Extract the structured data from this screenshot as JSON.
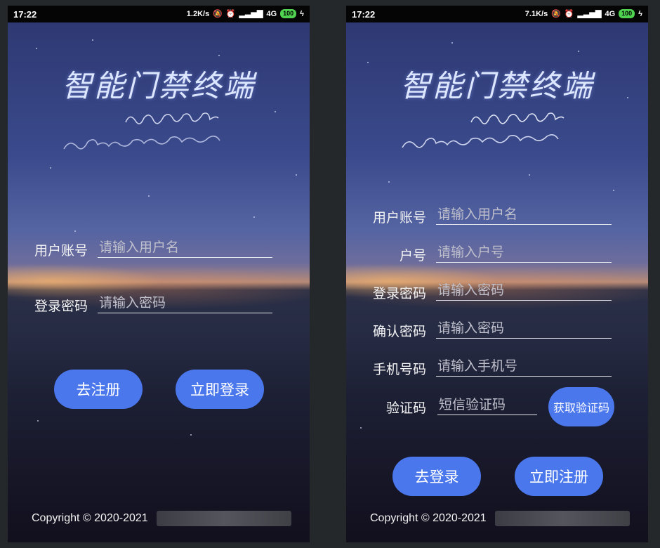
{
  "left_screen": {
    "status": {
      "time": "17:22",
      "speed": "1.2K/s",
      "network": "4G",
      "battery": "100"
    },
    "title": "智能门禁终端",
    "fields": [
      {
        "label": "用户账号",
        "placeholder": "请输入用户名"
      },
      {
        "label": "登录密码",
        "placeholder": "请输入密码"
      }
    ],
    "buttons": {
      "register": "去注册",
      "login": "立即登录"
    },
    "copyright": "Copyright © 2020-2021"
  },
  "right_screen": {
    "status": {
      "time": "17:22",
      "speed": "7.1K/s",
      "network": "4G",
      "battery": "100"
    },
    "title": "智能门禁终端",
    "fields": [
      {
        "label": "用户账号",
        "placeholder": "请输入用户名"
      },
      {
        "label": "户号",
        "placeholder": "请输入户号"
      },
      {
        "label": "登录密码",
        "placeholder": "请输入密码"
      },
      {
        "label": "确认密码",
        "placeholder": "请输入密码"
      },
      {
        "label": "手机号码",
        "placeholder": "请输入手机号"
      },
      {
        "label": "验证码",
        "placeholder": "短信验证码"
      }
    ],
    "sms_button": "获取验证码",
    "buttons": {
      "login": "去登录",
      "register": "立即注册"
    },
    "copyright": "Copyright © 2020-2021"
  },
  "colors": {
    "accent": "#4a77ec",
    "statusbar": "#050506",
    "battery": "#4fd24f"
  },
  "icons": [
    "mute-icon",
    "alarm-icon",
    "signal-icon",
    "hd-icon",
    "battery-icon",
    "charging-icon"
  ]
}
